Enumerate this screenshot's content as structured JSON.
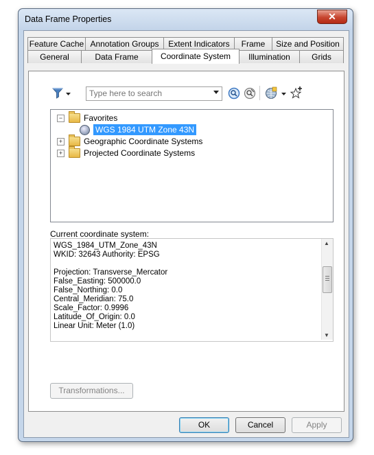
{
  "window": {
    "title": "Data Frame Properties",
    "close_glyph": "✕"
  },
  "tabs": {
    "row1": [
      "Feature Cache",
      "Annotation Groups",
      "Extent Indicators",
      "Frame",
      "Size and Position"
    ],
    "row2": [
      "General",
      "Data Frame",
      "Coordinate System",
      "Illumination",
      "Grids"
    ],
    "active": "Coordinate System"
  },
  "toolbar": {
    "filter_icon": "filter-icon",
    "search_placeholder": "Type here to search",
    "search_icon": "magnifier-icon",
    "clear_search_icon": "clear-search-icon",
    "add_coordinate_system_icon": "globe-add-icon",
    "favorites_icon": "star-add-icon"
  },
  "tree": {
    "favorites_label": "Favorites",
    "favorite_item": "WGS 1984 UTM Zone 43N",
    "geographic_label": "Geographic Coordinate Systems",
    "projected_label": "Projected Coordinate Systems",
    "expander_collapsed": "+",
    "expander_expanded": "−"
  },
  "current": {
    "label": "Current coordinate system:",
    "lines": [
      "WGS_1984_UTM_Zone_43N",
      "WKID: 32643 Authority: EPSG",
      "",
      "Projection: Transverse_Mercator",
      "False_Easting: 500000.0",
      "False_Northing: 0.0",
      "Central_Meridian: 75.0",
      "Scale_Factor: 0.9996",
      "Latitude_Of_Origin: 0.0",
      "Linear Unit: Meter (1.0)"
    ]
  },
  "buttons": {
    "transformations": "Transformations...",
    "ok": "OK",
    "cancel": "Cancel",
    "apply": "Apply"
  },
  "scroll": {
    "up_arrow": "▲",
    "down_arrow": "▼"
  }
}
